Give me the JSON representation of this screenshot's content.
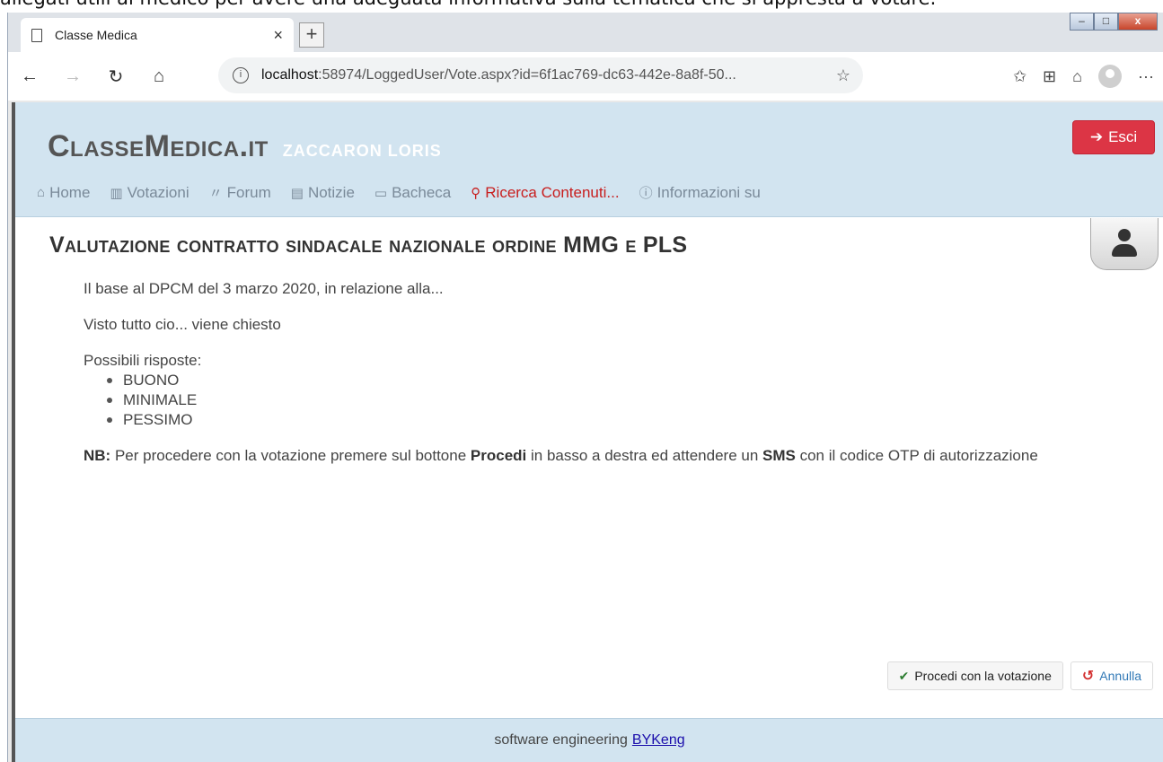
{
  "doc_crop_text": "allegati utili al medico per avere una adeguata informativa sulla tematica che si appresta a votare.",
  "window": {
    "minimize": "–",
    "maximize": "□",
    "close": "x"
  },
  "browser": {
    "tab_title": "Classe Medica",
    "tab_close": "×",
    "new_tab": "+",
    "url_host": "localhost",
    "url_path": ":58974/LoggedUser/Vote.aspx?id=6f1ac769-dc63-442e-8a8f-50..."
  },
  "header": {
    "brand": "ClasseMedica.it",
    "user": "ZACCARON LORIS",
    "logout_label": "Esci"
  },
  "nav": [
    {
      "label": "Home",
      "icon": "home-icon"
    },
    {
      "label": "Votazioni",
      "icon": "ballot-icon"
    },
    {
      "label": "Forum",
      "icon": "forum-icon"
    },
    {
      "label": "Notizie",
      "icon": "news-icon"
    },
    {
      "label": "Bacheca",
      "icon": "board-icon"
    },
    {
      "label": "Ricerca Contenuti...",
      "icon": "search-icon"
    },
    {
      "label": "Informazioni su",
      "icon": "info-icon"
    }
  ],
  "vote": {
    "title": "Valutazione contratto sindacale nazionale ordine MMG e PLS",
    "intro": "Il base al DPCM del 3 marzo 2020, in relazione alla...",
    "question": "Visto tutto cio... viene chiesto",
    "answers_label": "Possibili risposte:",
    "answers": [
      "BUONO",
      "MINIMALE",
      "PESSIMO"
    ],
    "note_prefix": "NB:",
    "note_part1": " Per procedere con la votazione premere sul bottone ",
    "note_bold1": "Procedi",
    "note_part2": " in basso a destra ed attendere un ",
    "note_bold2": "SMS",
    "note_part3": " con il codice OTP di autorizzazione"
  },
  "actions": {
    "proceed_label": "Procedi con la votazione",
    "cancel_label": "Annulla"
  },
  "footer": {
    "text": "software engineering",
    "link": "BYKeng"
  }
}
